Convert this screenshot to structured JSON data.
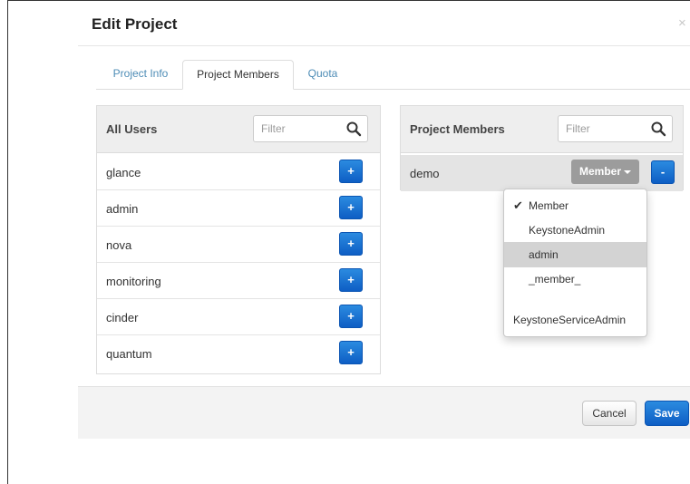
{
  "dialog": {
    "title": "Edit Project",
    "close_glyph": "×"
  },
  "tabs": [
    {
      "label": "Project Info",
      "active": false
    },
    {
      "label": "Project Members",
      "active": true
    },
    {
      "label": "Quota",
      "active": false
    }
  ],
  "all_users": {
    "title": "All Users",
    "filter_placeholder": "Filter",
    "add_glyph": "+",
    "users": [
      "glance",
      "admin",
      "nova",
      "monitoring",
      "cinder",
      "quantum"
    ]
  },
  "project_members": {
    "title": "Project Members",
    "filter_placeholder": "Filter",
    "remove_glyph": "-",
    "members": [
      {
        "name": "demo",
        "role": "Member"
      }
    ]
  },
  "role_dropdown": {
    "check_glyph": "✔",
    "items": [
      {
        "label": "Member",
        "checked": true,
        "hovered": false
      },
      {
        "label": "KeystoneAdmin",
        "checked": false,
        "hovered": false
      },
      {
        "label": "admin",
        "checked": false,
        "hovered": true
      },
      {
        "label": "_member_",
        "checked": false,
        "hovered": false
      },
      {
        "label": "KeystoneServiceAdmin",
        "checked": false,
        "hovered": false
      }
    ]
  },
  "footer": {
    "cancel_label": "Cancel",
    "save_label": "Save"
  },
  "colors": {
    "primary_button": "#1a6fd3",
    "link": "#4d8cb6",
    "role_button": "#9c9c9c",
    "hover_item": "#d3d3d3"
  },
  "icons": {
    "search": "search-icon",
    "close": "close-icon",
    "check": "check-icon",
    "caret": "caret-down-icon"
  }
}
